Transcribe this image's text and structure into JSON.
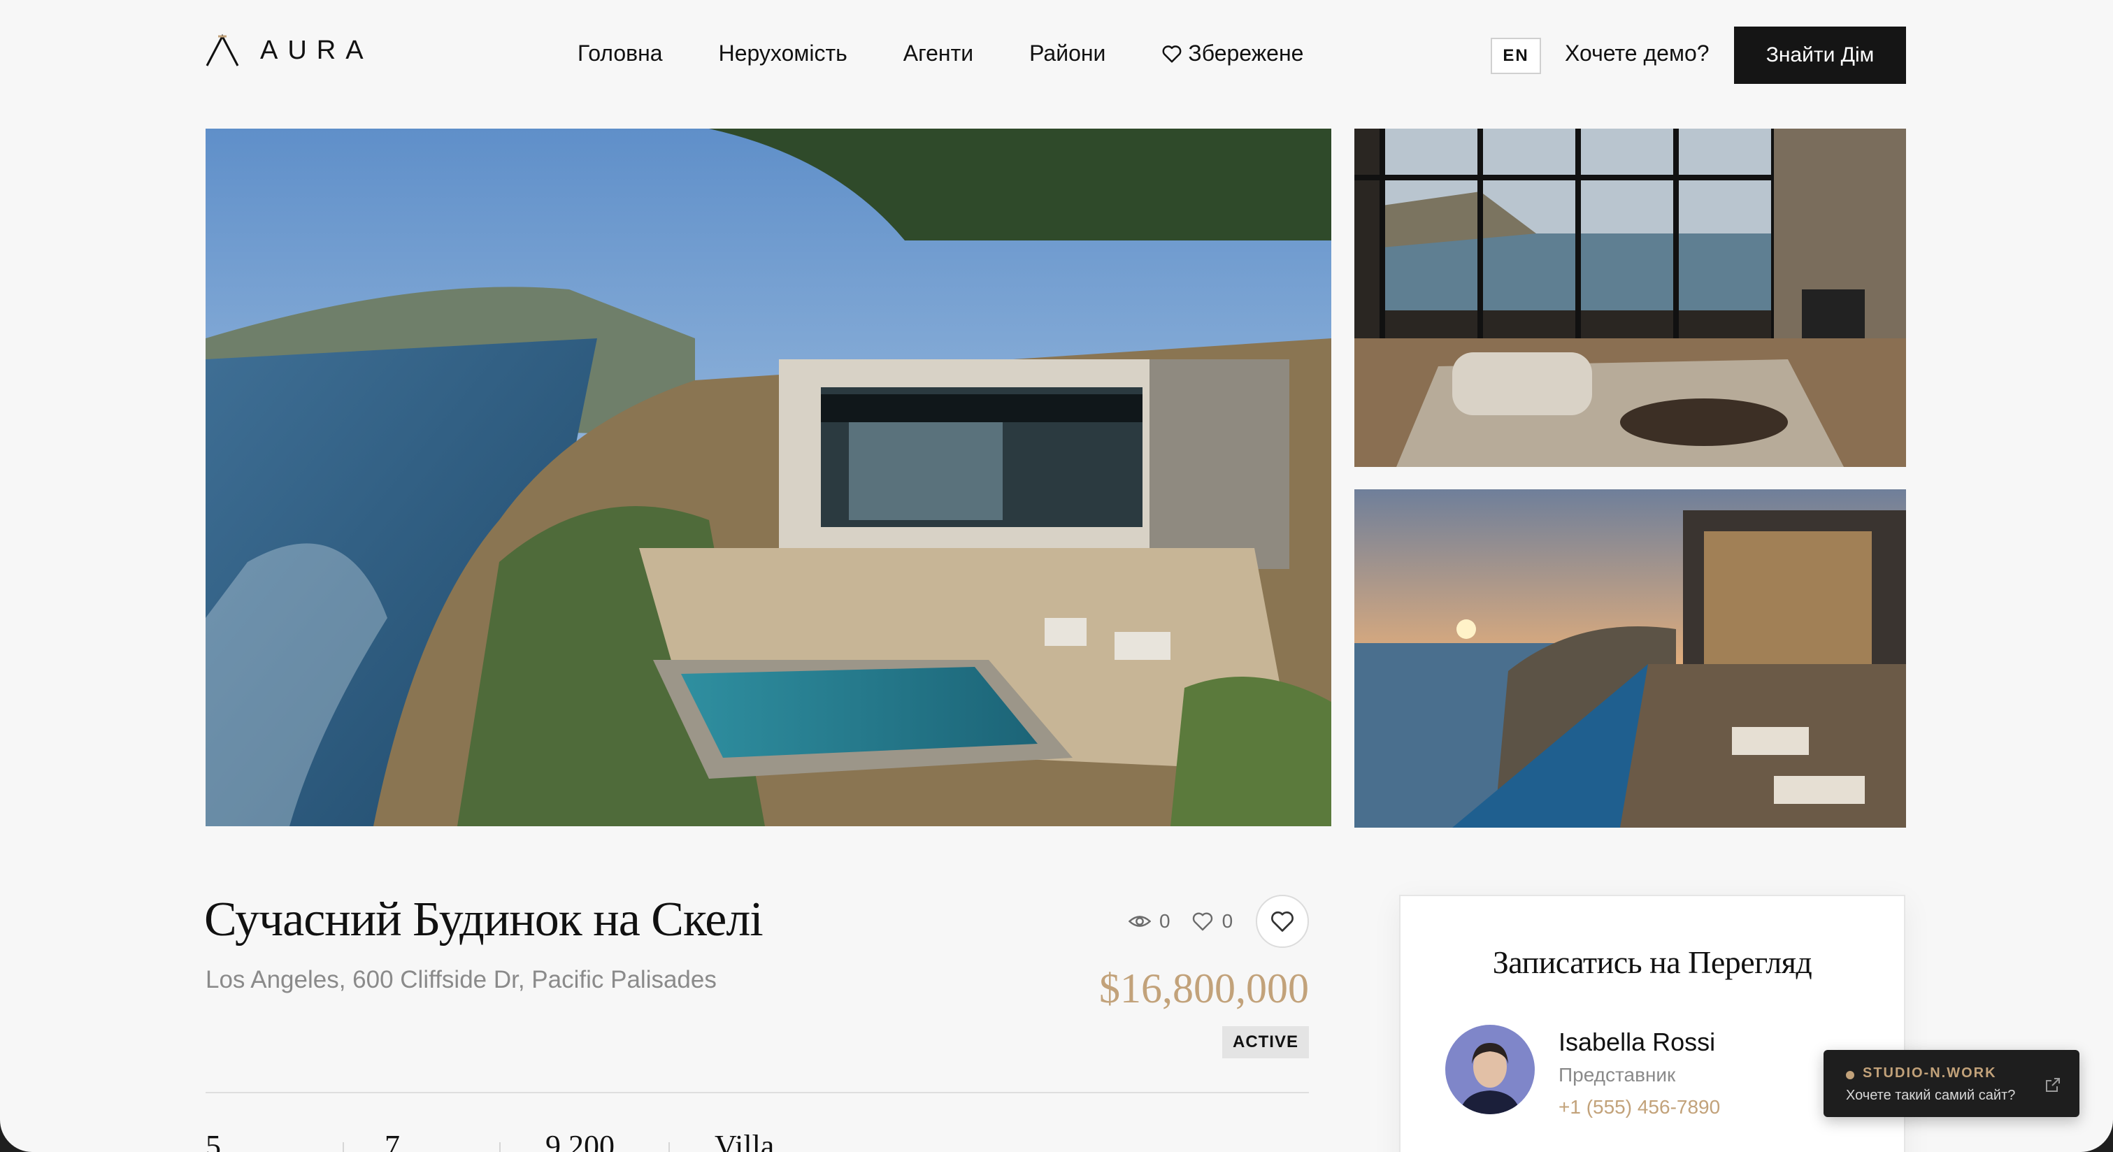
{
  "brand": {
    "name": "AURA",
    "logo_icon": "aura-logo-icon"
  },
  "nav": {
    "items": [
      {
        "label": "Головна"
      },
      {
        "label": "Нерухомість"
      },
      {
        "label": "Агенти"
      },
      {
        "label": "Райони"
      },
      {
        "label": "Збережене",
        "icon": "heart-icon"
      }
    ]
  },
  "header": {
    "lang": "EN",
    "demo_link": "Хочете демо?",
    "cta": "Знайти Дім"
  },
  "gallery": {
    "images": [
      {
        "subject": "cliffside villa with infinity pool"
      },
      {
        "subject": "living room with ocean view"
      },
      {
        "subject": "sunset pool deck"
      }
    ]
  },
  "listing": {
    "title": "Сучасний Будинок на Скелі",
    "address": "Los Angeles, 600 Cliffside Dr, Pacific Palisades",
    "views": "0",
    "likes": "0",
    "price": "$16,800,000",
    "status": "ACTIVE",
    "facts": [
      "5",
      "7",
      "9,200",
      "Villa"
    ]
  },
  "booking": {
    "title": "Записатись на Перегляд",
    "agent": {
      "name": "Isabella Rossi",
      "role": "Представник",
      "phone": "+1 (555) 456-7890"
    }
  },
  "promo": {
    "brand": "STUDIO-N.WORK",
    "text": "Хочете такий самий сайт?"
  },
  "colors": {
    "accent_gold": "#c2a27a",
    "dark": "#151515",
    "background": "#f7f7f7"
  }
}
